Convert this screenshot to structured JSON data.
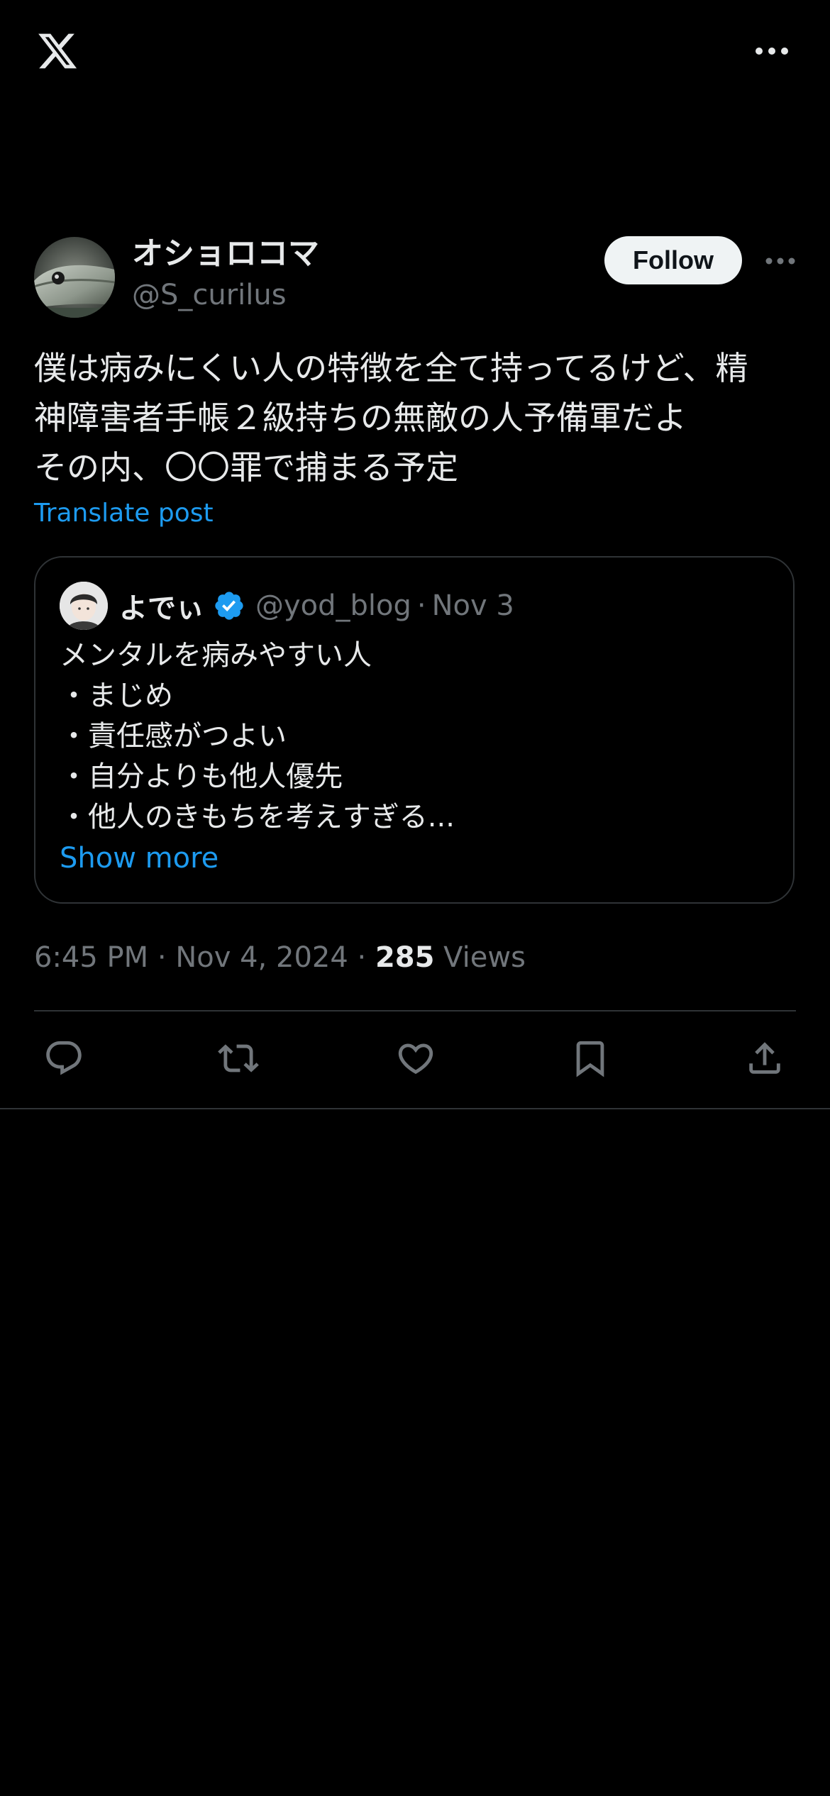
{
  "app": {
    "logo_icon": "x-logo-icon",
    "more_icon": "more-horizontal-icon"
  },
  "author": {
    "display_name": "オショロコマ",
    "handle": "@S_curilus",
    "avatar_icon": "fish-avatar",
    "follow_label": "Follow"
  },
  "post": {
    "text": "僕は病みにくい人の特徴を全て持ってるけど、精\n神障害者手帳２級持ちの無敵の人予備軍だよ\nその内、〇〇罪で捕まる予定",
    "translate_label": "Translate post"
  },
  "quote": {
    "display_name": "よでぃ",
    "verified_icon": "verified-badge-icon",
    "handle": "@yod_blog",
    "separator": "·",
    "date": "Nov 3",
    "text": "メンタルを病みやすい人\n・まじめ\n・責任感がつよい\n・自分よりも他人優先\n・他人のきもちを考えすぎる...",
    "show_more_label": "Show more"
  },
  "meta": {
    "time": "6:45 PM",
    "separator": "·",
    "date": "Nov 4, 2024",
    "views_count": "285",
    "views_label": "Views"
  },
  "actions": [
    {
      "name": "reply",
      "icon": "reply-icon"
    },
    {
      "name": "repost",
      "icon": "repost-icon"
    },
    {
      "name": "like",
      "icon": "heart-icon"
    },
    {
      "name": "bookmark",
      "icon": "bookmark-icon"
    },
    {
      "name": "share",
      "icon": "share-icon"
    }
  ],
  "colors": {
    "background": "#000000",
    "text": "#e7e9ea",
    "secondary": "#71767b",
    "link": "#1d9bf0",
    "border": "#2f3336",
    "follow_bg": "#eff3f4"
  }
}
